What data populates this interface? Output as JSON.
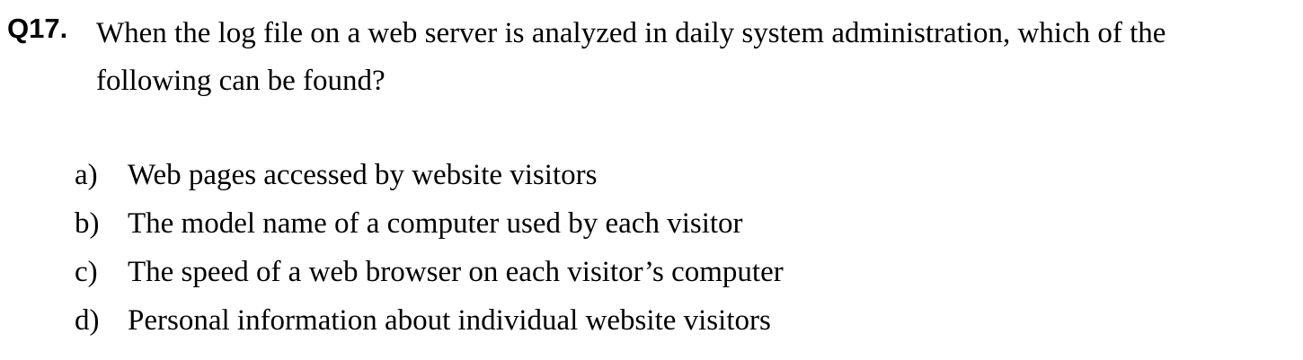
{
  "question": {
    "number": "Q17.",
    "text": "When the log file on a web server is analyzed in daily system administration, which of the following can be found?"
  },
  "options": [
    {
      "letter": "a)",
      "text": "Web pages accessed by website visitors"
    },
    {
      "letter": "b)",
      "text": "The model name of a computer used by each visitor"
    },
    {
      "letter": "c)",
      "text": "The speed of a web browser on each visitor’s computer"
    },
    {
      "letter": "d)",
      "text": "Personal information about individual website visitors"
    }
  ]
}
